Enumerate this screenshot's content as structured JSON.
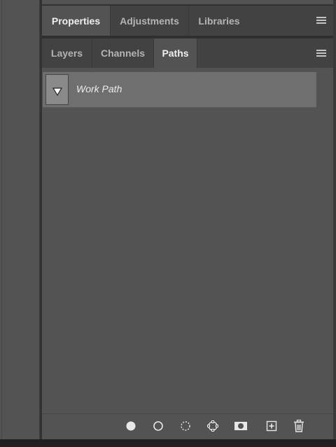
{
  "properties_tabs": [
    {
      "label": "Properties",
      "active": true
    },
    {
      "label": "Adjustments",
      "active": false
    },
    {
      "label": "Libraries",
      "active": false
    }
  ],
  "paths_tabs": [
    {
      "label": "Layers",
      "active": false
    },
    {
      "label": "Channels",
      "active": false
    },
    {
      "label": "Paths",
      "active": true
    }
  ],
  "paths": [
    {
      "name": "Work Path",
      "selected": true
    }
  ],
  "bottom_icons": [
    "fill-path-icon",
    "stroke-path-icon",
    "load-as-selection-icon",
    "make-work-path-icon",
    "add-mask-icon",
    "create-new-path-icon",
    "delete-path-icon"
  ],
  "colors": {
    "panel_bg": "#535353",
    "tabbar_bg": "#424242",
    "selected_row": "#6f6f6f",
    "text_active": "#f0f0f0",
    "text_inactive": "#b4b4b4"
  }
}
